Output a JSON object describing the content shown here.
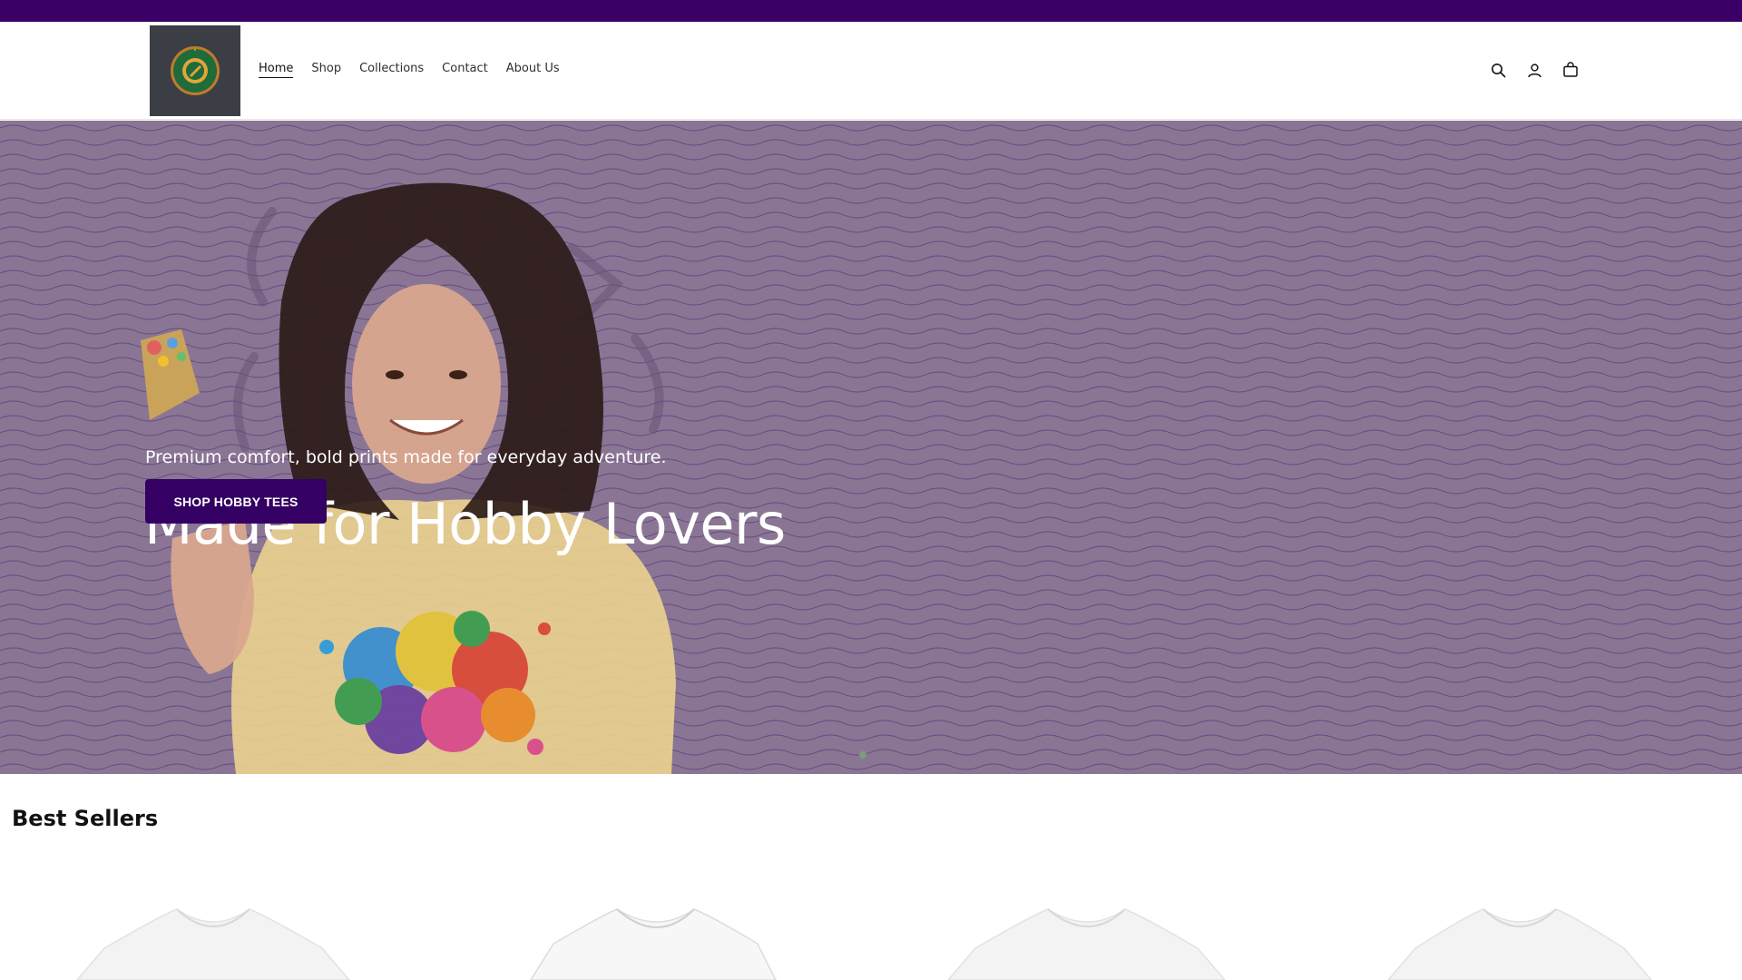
{
  "announcement": {
    "color": "#3a0066"
  },
  "header": {
    "logo_icon": "passion-print-tees-logo",
    "nav": [
      {
        "label": "Home",
        "active": true
      },
      {
        "label": "Shop"
      },
      {
        "label": "Collections"
      },
      {
        "label": "Contact"
      },
      {
        "label": "About Us"
      }
    ],
    "icons": [
      "search-icon",
      "account-icon",
      "cart-icon"
    ]
  },
  "hero": {
    "heading": "Made for Hobby Lovers",
    "subheading": "Premium comfort, bold prints made for everyday adventure.",
    "button_label": "SHOP HOBBY TEES",
    "button_color": "#340063",
    "overlay_color": "#8a7694"
  },
  "best_sellers": {
    "title": "Best Sellers",
    "products": [
      {
        "image": "white-t-shirt"
      },
      {
        "image": "white-t-shirt"
      },
      {
        "image": "white-t-shirt"
      },
      {
        "image": "white-t-shirt"
      }
    ]
  }
}
